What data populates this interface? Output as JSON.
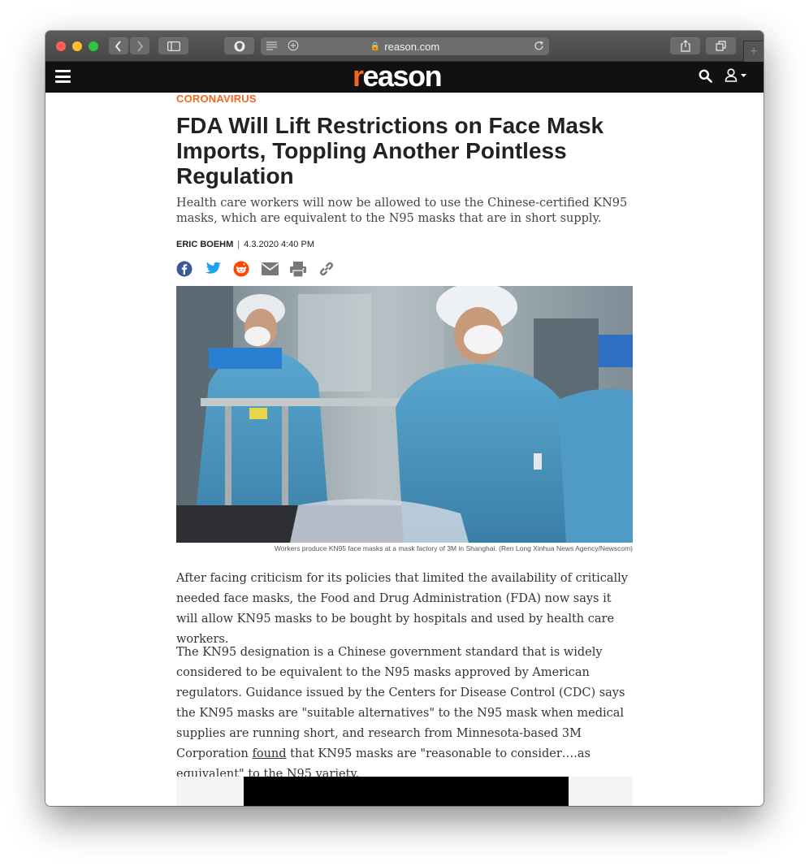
{
  "browser": {
    "url": "reason.com",
    "lock_glyph": "🔒"
  },
  "site": {
    "logo_prefix": "r",
    "logo_rest": "eason",
    "brand_color": "#f26722"
  },
  "article": {
    "category": "CORONAVIRUS",
    "headline": "FDA Will Lift Restrictions on Face Mask Imports, Toppling Another Pointless Regulation",
    "dek": "Health care workers will now be allowed to use the Chinese-certified KN95 masks, which are equivalent to the N95 masks that are in short supply.",
    "author": "ERIC BOEHM",
    "separator": "|",
    "date": "4.3.2020 4:40 PM",
    "share_icons": [
      "facebook-icon",
      "twitter-icon",
      "reddit-icon",
      "email-icon",
      "print-icon",
      "link-icon"
    ],
    "image_caption": "Workers produce KN95 face masks at a mask factory of 3M in Shanghai. (Ren Long Xinhua News Agency/Newscom)",
    "paragraph1": "After facing criticism for its policies that limited the availability of critically needed face masks, the Food and Drug Administration (FDA) now says it will allow KN95 masks to be bought by hospitals and used by health care workers.",
    "paragraph2_before": "The KN95 designation is a Chinese government standard that is widely considered to be equivalent to the N95 masks approved by American regulators. Guidance issued by the Centers for Disease Control (CDC) says the KN95 masks are \"suitable alternatives\" to the N95 mask when medical supplies are running short, and research from Minnesota-based 3M Corporation ",
    "paragraph2_link": "found",
    "paragraph2_after": " that KN95 masks are \"reasonable to consider….as equivalent\" to the N95 variety."
  }
}
